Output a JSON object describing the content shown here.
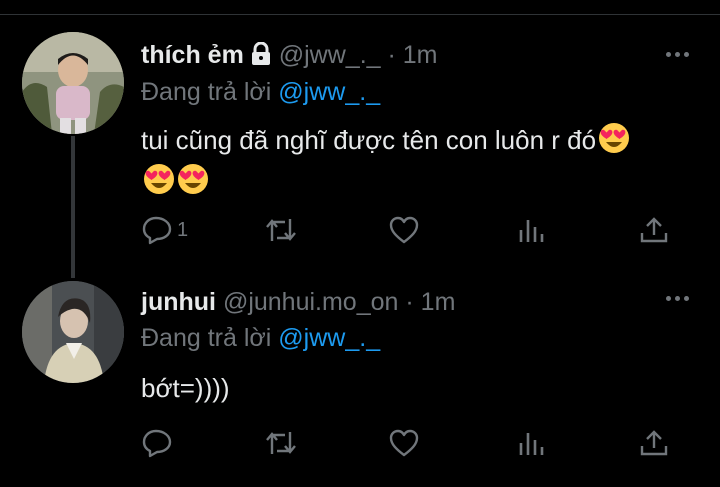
{
  "tweets": [
    {
      "display_name": "thích ẻm",
      "protected_icon": "lock-icon",
      "handle": "@jww_._",
      "separator": "·",
      "time": "1m",
      "reply_prefix": "Đang trả lời",
      "reply_to": "@jww_._",
      "text": "tui cũng đã nghĩ được tên con luôn r đó",
      "emoji_count": 3,
      "actions": {
        "reply_count": "1",
        "retweet_count": "",
        "like_count": ""
      }
    },
    {
      "display_name": "junhui",
      "handle": "@junhui.mo_on",
      "separator": "·",
      "time": "1m",
      "reply_prefix": "Đang trả lời",
      "reply_to": "@jww_._",
      "text": "bớt=))))",
      "actions": {
        "reply_count": "",
        "retweet_count": "",
        "like_count": ""
      }
    }
  ],
  "colors": {
    "background": "#000000",
    "text": "#e7e9ea",
    "muted": "#71767b",
    "link": "#1d9bf0",
    "thread_line": "#333639"
  }
}
